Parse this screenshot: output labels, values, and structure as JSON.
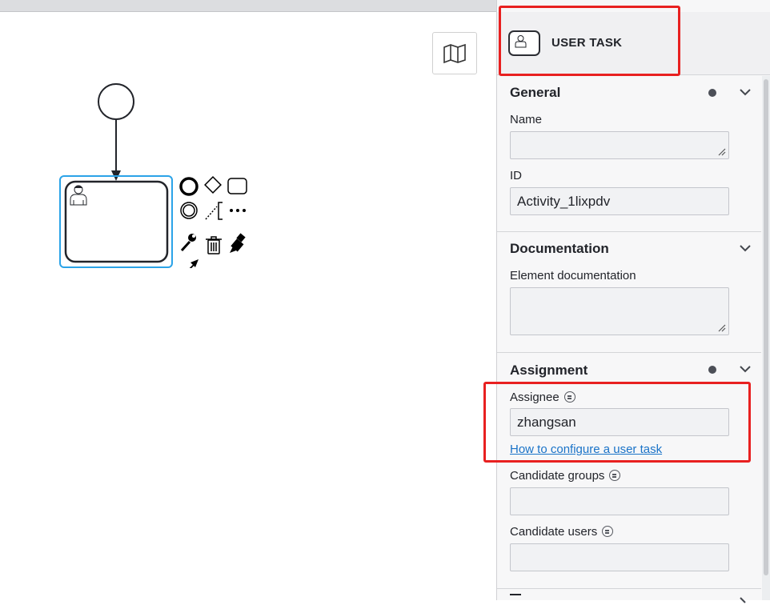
{
  "panel": {
    "element_type": "USER TASK",
    "general": {
      "title": "General",
      "name_label": "Name",
      "name_value": "",
      "id_label": "ID",
      "id_value": "Activity_1lixpdv"
    },
    "documentation": {
      "title": "Documentation",
      "element_doc_label": "Element documentation",
      "element_doc_value": ""
    },
    "assignment": {
      "title": "Assignment",
      "assignee_label": "Assignee",
      "assignee_value": "zhangsan",
      "help_link": "How to configure a user task",
      "candidate_groups_label": "Candidate groups",
      "candidate_groups_value": "",
      "candidate_users_label": "Candidate users",
      "candidate_users_value": ""
    }
  },
  "canvas": {
    "elements": [
      "start-event",
      "sequence-flow",
      "user-task"
    ],
    "context_pad_icons": [
      "end-event-icon",
      "gateway-icon",
      "task-icon",
      "intermediate-event-icon",
      "text-annotation-icon",
      "more-icon",
      "wrench-icon",
      "trash-icon",
      "color-icon",
      "connect-arrow-icon"
    ],
    "map_icon": "map-icon"
  },
  "colors": {
    "selection": "#2ba3e8",
    "highlight": "#e82020",
    "link": "#1a73c8"
  }
}
